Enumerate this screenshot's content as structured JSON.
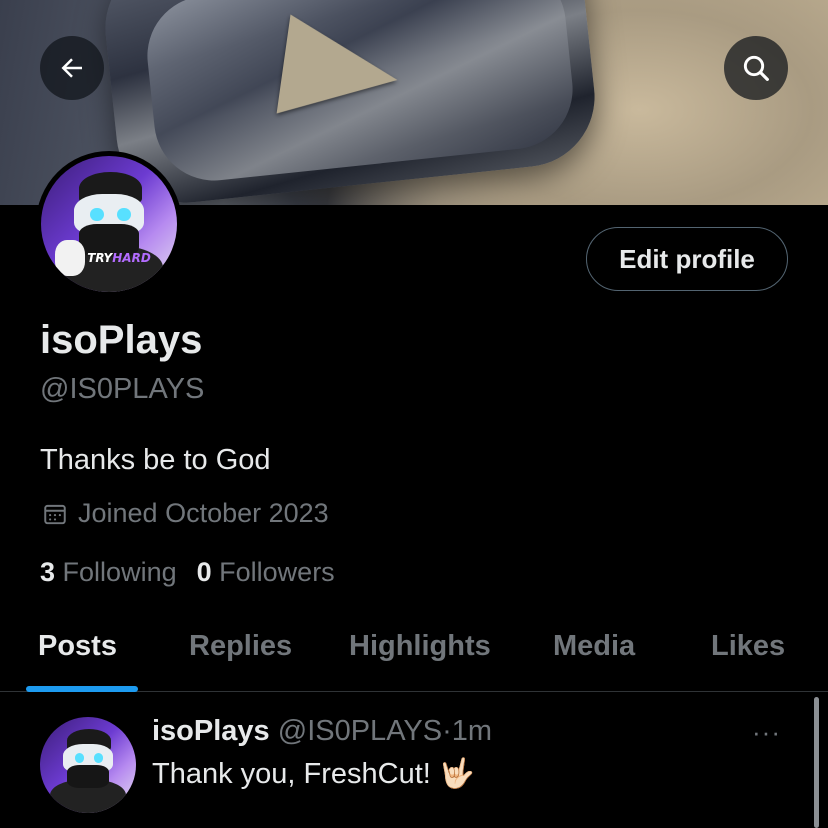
{
  "header": {
    "back_icon": "arrow-left-icon",
    "search_icon": "search-icon"
  },
  "profile": {
    "avatar_label_a": "TRY",
    "avatar_label_b": "HARD",
    "edit_button": "Edit profile",
    "name": "isoPlays",
    "handle": "@IS0PLAYS",
    "bio": "Thanks be to God",
    "joined_icon": "calendar-icon",
    "joined": "Joined October 2023",
    "following_count": "3",
    "following_label": "Following",
    "followers_count": "0",
    "followers_label": "Followers"
  },
  "tabs": [
    {
      "label": "Posts",
      "active": true
    },
    {
      "label": "Replies",
      "active": false
    },
    {
      "label": "Highlights",
      "active": false
    },
    {
      "label": "Media",
      "active": false
    },
    {
      "label": "Likes",
      "active": false
    }
  ],
  "post": {
    "author_name": "isoPlays",
    "author_handle": "@IS0PLAYS",
    "separator": "·",
    "time": "1m",
    "text": "Thank you, FreshCut! 🤟🏻",
    "more_label": "···"
  },
  "colors": {
    "background": "#000000",
    "text_primary": "#e7e9ea",
    "text_secondary": "#71767b",
    "accent": "#1d9bf0",
    "border": "#2f3336"
  }
}
